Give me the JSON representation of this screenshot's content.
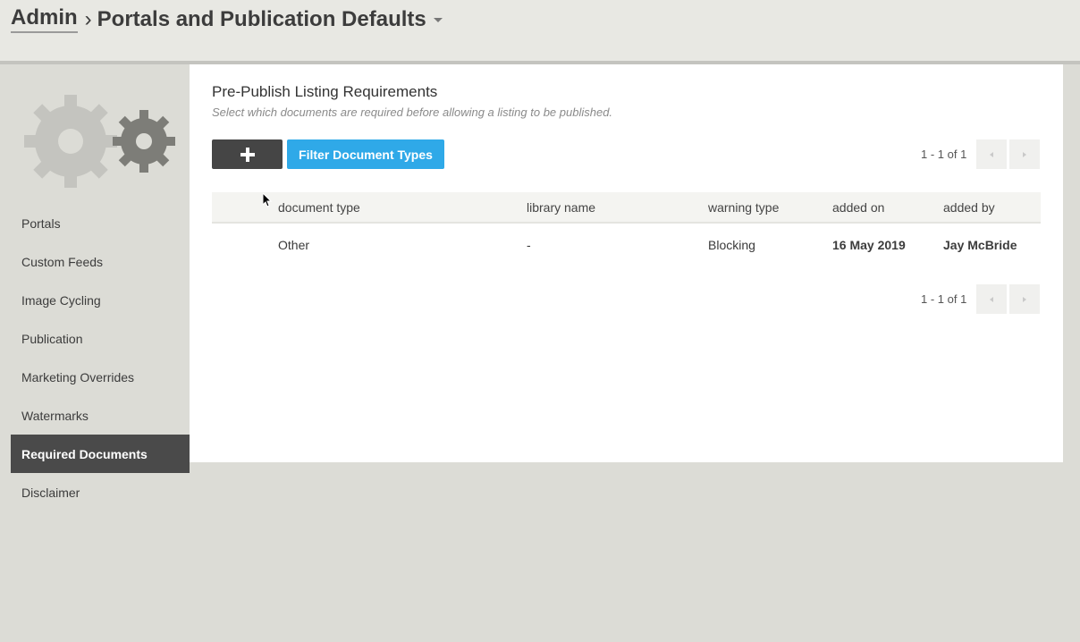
{
  "header": {
    "breadcrumb_root": "Admin",
    "separator": "›",
    "page_title": "Portals and Publication Defaults"
  },
  "sidebar": {
    "items": [
      {
        "label": "Portals",
        "active": false
      },
      {
        "label": "Custom Feeds",
        "active": false
      },
      {
        "label": "Image Cycling",
        "active": false
      },
      {
        "label": "Publication",
        "active": false
      },
      {
        "label": "Marketing Overrides",
        "active": false
      },
      {
        "label": "Watermarks",
        "active": false
      },
      {
        "label": "Required Documents",
        "active": true
      },
      {
        "label": "Disclaimer",
        "active": false
      }
    ]
  },
  "main": {
    "title": "Pre-Publish Listing Requirements",
    "subtitle": "Select which documents are required before allowing a listing to be published.",
    "add_button_icon": "plus-icon",
    "filter_button": "Filter Document Types",
    "pager_top": "1 - 1 of 1",
    "pager_bottom": "1 - 1 of 1"
  },
  "table": {
    "columns": [
      "document type",
      "library name",
      "warning type",
      "added on",
      "added by"
    ],
    "rows": [
      {
        "document_type": "Other",
        "library_name": "-",
        "warning_type": "Blocking",
        "added_on": "16 May 2019",
        "added_by": "Jay McBride"
      }
    ]
  },
  "colors": {
    "accent": "#2fa9e8",
    "dark_button": "#454545",
    "active_nav": "#4a4a4a",
    "background": "#dcdcd6"
  }
}
